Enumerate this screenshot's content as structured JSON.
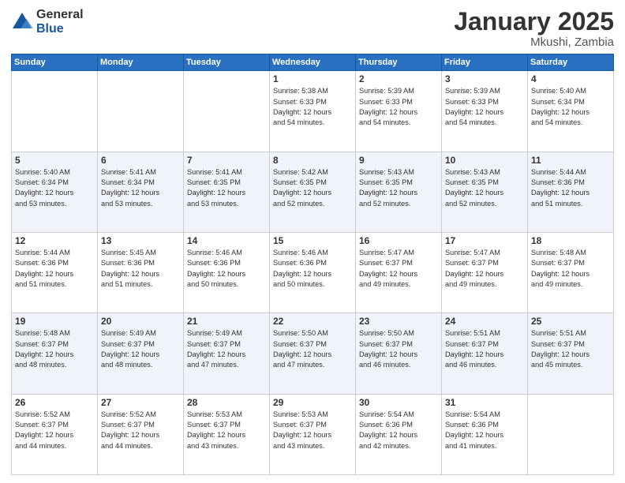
{
  "header": {
    "logo_general": "General",
    "logo_blue": "Blue",
    "month": "January 2025",
    "location": "Mkushi, Zambia"
  },
  "days_of_week": [
    "Sunday",
    "Monday",
    "Tuesday",
    "Wednesday",
    "Thursday",
    "Friday",
    "Saturday"
  ],
  "weeks": [
    {
      "stripe": false,
      "days": [
        {
          "num": "",
          "info": ""
        },
        {
          "num": "",
          "info": ""
        },
        {
          "num": "",
          "info": ""
        },
        {
          "num": "1",
          "info": "Sunrise: 5:38 AM\nSunset: 6:33 PM\nDaylight: 12 hours\nand 54 minutes."
        },
        {
          "num": "2",
          "info": "Sunrise: 5:39 AM\nSunset: 6:33 PM\nDaylight: 12 hours\nand 54 minutes."
        },
        {
          "num": "3",
          "info": "Sunrise: 5:39 AM\nSunset: 6:33 PM\nDaylight: 12 hours\nand 54 minutes."
        },
        {
          "num": "4",
          "info": "Sunrise: 5:40 AM\nSunset: 6:34 PM\nDaylight: 12 hours\nand 54 minutes."
        }
      ]
    },
    {
      "stripe": true,
      "days": [
        {
          "num": "5",
          "info": "Sunrise: 5:40 AM\nSunset: 6:34 PM\nDaylight: 12 hours\nand 53 minutes."
        },
        {
          "num": "6",
          "info": "Sunrise: 5:41 AM\nSunset: 6:34 PM\nDaylight: 12 hours\nand 53 minutes."
        },
        {
          "num": "7",
          "info": "Sunrise: 5:41 AM\nSunset: 6:35 PM\nDaylight: 12 hours\nand 53 minutes."
        },
        {
          "num": "8",
          "info": "Sunrise: 5:42 AM\nSunset: 6:35 PM\nDaylight: 12 hours\nand 52 minutes."
        },
        {
          "num": "9",
          "info": "Sunrise: 5:43 AM\nSunset: 6:35 PM\nDaylight: 12 hours\nand 52 minutes."
        },
        {
          "num": "10",
          "info": "Sunrise: 5:43 AM\nSunset: 6:35 PM\nDaylight: 12 hours\nand 52 minutes."
        },
        {
          "num": "11",
          "info": "Sunrise: 5:44 AM\nSunset: 6:36 PM\nDaylight: 12 hours\nand 51 minutes."
        }
      ]
    },
    {
      "stripe": false,
      "days": [
        {
          "num": "12",
          "info": "Sunrise: 5:44 AM\nSunset: 6:36 PM\nDaylight: 12 hours\nand 51 minutes."
        },
        {
          "num": "13",
          "info": "Sunrise: 5:45 AM\nSunset: 6:36 PM\nDaylight: 12 hours\nand 51 minutes."
        },
        {
          "num": "14",
          "info": "Sunrise: 5:46 AM\nSunset: 6:36 PM\nDaylight: 12 hours\nand 50 minutes."
        },
        {
          "num": "15",
          "info": "Sunrise: 5:46 AM\nSunset: 6:36 PM\nDaylight: 12 hours\nand 50 minutes."
        },
        {
          "num": "16",
          "info": "Sunrise: 5:47 AM\nSunset: 6:37 PM\nDaylight: 12 hours\nand 49 minutes."
        },
        {
          "num": "17",
          "info": "Sunrise: 5:47 AM\nSunset: 6:37 PM\nDaylight: 12 hours\nand 49 minutes."
        },
        {
          "num": "18",
          "info": "Sunrise: 5:48 AM\nSunset: 6:37 PM\nDaylight: 12 hours\nand 49 minutes."
        }
      ]
    },
    {
      "stripe": true,
      "days": [
        {
          "num": "19",
          "info": "Sunrise: 5:48 AM\nSunset: 6:37 PM\nDaylight: 12 hours\nand 48 minutes."
        },
        {
          "num": "20",
          "info": "Sunrise: 5:49 AM\nSunset: 6:37 PM\nDaylight: 12 hours\nand 48 minutes."
        },
        {
          "num": "21",
          "info": "Sunrise: 5:49 AM\nSunset: 6:37 PM\nDaylight: 12 hours\nand 47 minutes."
        },
        {
          "num": "22",
          "info": "Sunrise: 5:50 AM\nSunset: 6:37 PM\nDaylight: 12 hours\nand 47 minutes."
        },
        {
          "num": "23",
          "info": "Sunrise: 5:50 AM\nSunset: 6:37 PM\nDaylight: 12 hours\nand 46 minutes."
        },
        {
          "num": "24",
          "info": "Sunrise: 5:51 AM\nSunset: 6:37 PM\nDaylight: 12 hours\nand 46 minutes."
        },
        {
          "num": "25",
          "info": "Sunrise: 5:51 AM\nSunset: 6:37 PM\nDaylight: 12 hours\nand 45 minutes."
        }
      ]
    },
    {
      "stripe": false,
      "days": [
        {
          "num": "26",
          "info": "Sunrise: 5:52 AM\nSunset: 6:37 PM\nDaylight: 12 hours\nand 44 minutes."
        },
        {
          "num": "27",
          "info": "Sunrise: 5:52 AM\nSunset: 6:37 PM\nDaylight: 12 hours\nand 44 minutes."
        },
        {
          "num": "28",
          "info": "Sunrise: 5:53 AM\nSunset: 6:37 PM\nDaylight: 12 hours\nand 43 minutes."
        },
        {
          "num": "29",
          "info": "Sunrise: 5:53 AM\nSunset: 6:37 PM\nDaylight: 12 hours\nand 43 minutes."
        },
        {
          "num": "30",
          "info": "Sunrise: 5:54 AM\nSunset: 6:36 PM\nDaylight: 12 hours\nand 42 minutes."
        },
        {
          "num": "31",
          "info": "Sunrise: 5:54 AM\nSunset: 6:36 PM\nDaylight: 12 hours\nand 41 minutes."
        },
        {
          "num": "",
          "info": ""
        }
      ]
    }
  ]
}
